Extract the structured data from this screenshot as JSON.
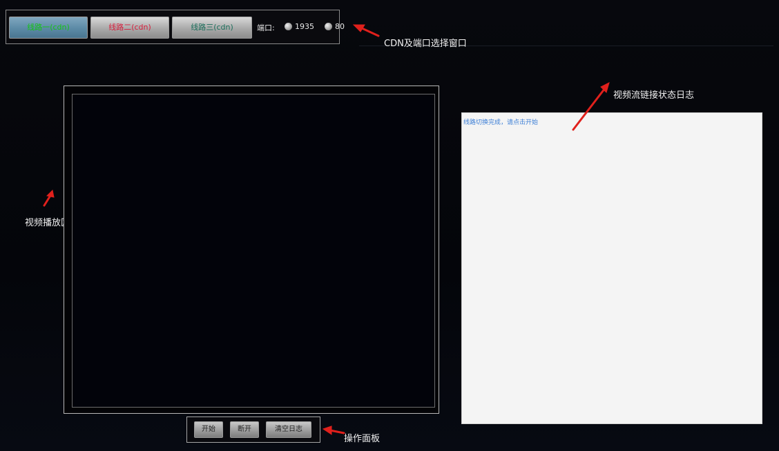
{
  "cdn_selector": {
    "line1_label": "线路一(cdn)",
    "line2_label": "线路二(cdn)",
    "line3_label": "线路三(cdn)",
    "port_label": "端口:",
    "port_options": [
      "1935",
      "80"
    ]
  },
  "annotations": {
    "cdn_window": "CDN及端口选择窗口",
    "log_window": "视频流链接状态日志",
    "video_area": "视频播放区域",
    "operation_panel": "操作面板"
  },
  "log": {
    "lines": [
      "线路切换完成，请点击开始"
    ]
  },
  "operation_panel": {
    "start_label": "开始",
    "disconnect_label": "断开",
    "clear_log_label": "清空日志"
  },
  "colors": {
    "line1_text": "#14c414",
    "line2_text": "#d81e3c",
    "line3_text": "#1a6e5a",
    "arrow": "#e0201c",
    "log_text": "#3d7fd6"
  }
}
